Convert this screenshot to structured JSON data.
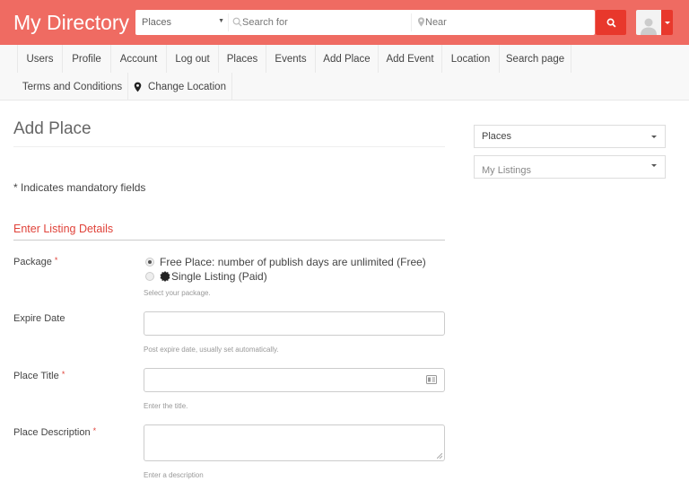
{
  "header": {
    "brand": "My Directory",
    "search_type": "Places",
    "search_placeholder": "Search for",
    "near_placeholder": "Near",
    "accent_color": "#ef6b62",
    "button_color": "#e8382c"
  },
  "nav": {
    "row1": [
      "Users",
      "Profile",
      "Account",
      "Log out",
      "Places",
      "Events",
      "Add Place",
      "Add Event",
      "Location",
      "Search page"
    ],
    "row2": [
      "Terms and Conditions",
      "Change Location"
    ]
  },
  "main": {
    "page_title": "Add Place",
    "mandatory_note": "*  Indicates mandatory fields",
    "section_title": "Enter Listing Details",
    "required_mark": "*",
    "package": {
      "label": "Package",
      "options": [
        {
          "label": "Free Place: number of publish days are unlimited (Free)",
          "checked": true
        },
        {
          "label": "Single Listing (Paid)",
          "checked": false
        }
      ],
      "help": "Select your package."
    },
    "expire_date": {
      "label": "Expire Date",
      "value": "",
      "help": "Post expire date, usually set automatically."
    },
    "place_title": {
      "label": "Place Title",
      "value": "",
      "help": "Enter the title."
    },
    "place_description": {
      "label": "Place Description",
      "value": "",
      "help": "Enter a description"
    }
  },
  "sidebar": {
    "select1": "Places",
    "select2": "My Listings"
  }
}
